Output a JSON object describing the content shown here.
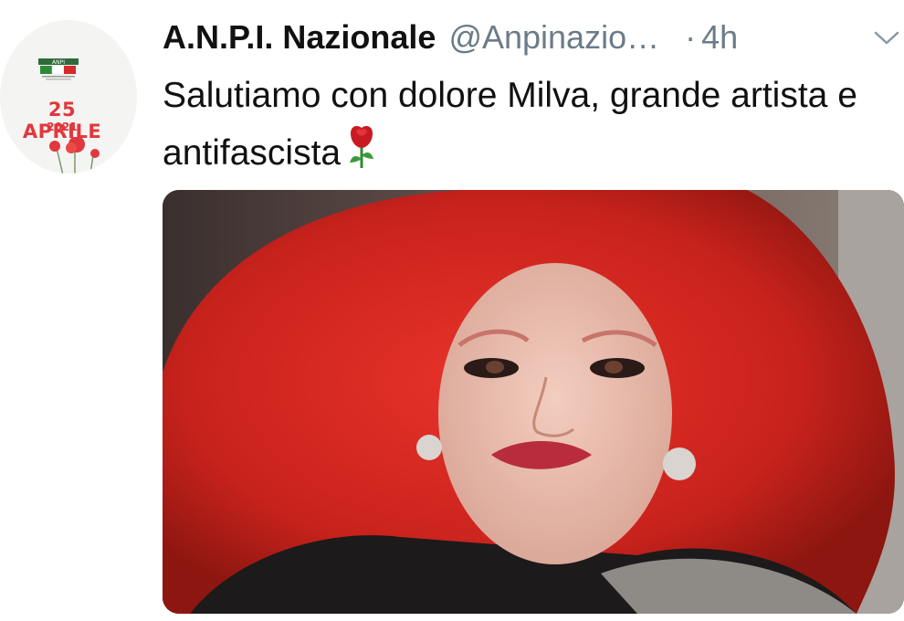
{
  "tweet": {
    "author_name": "A.N.P.I. Nazionale",
    "author_handle": "@Anpinazio…",
    "separator": "·",
    "timestamp": "4h",
    "text": "Salutiamo con dolore Milva, grande artista e antifascista",
    "emoji": "rose-emoji"
  },
  "avatar": {
    "badge_line1": "25 APRILE",
    "badge_line2": "2021",
    "accent_color": "#e0383e",
    "logo": "ANPI-logo-with-flag"
  },
  "icons": {
    "menu": "chevron-down-icon"
  },
  "media": {
    "description_hidden": true,
    "hair_color": "#d8261e"
  }
}
